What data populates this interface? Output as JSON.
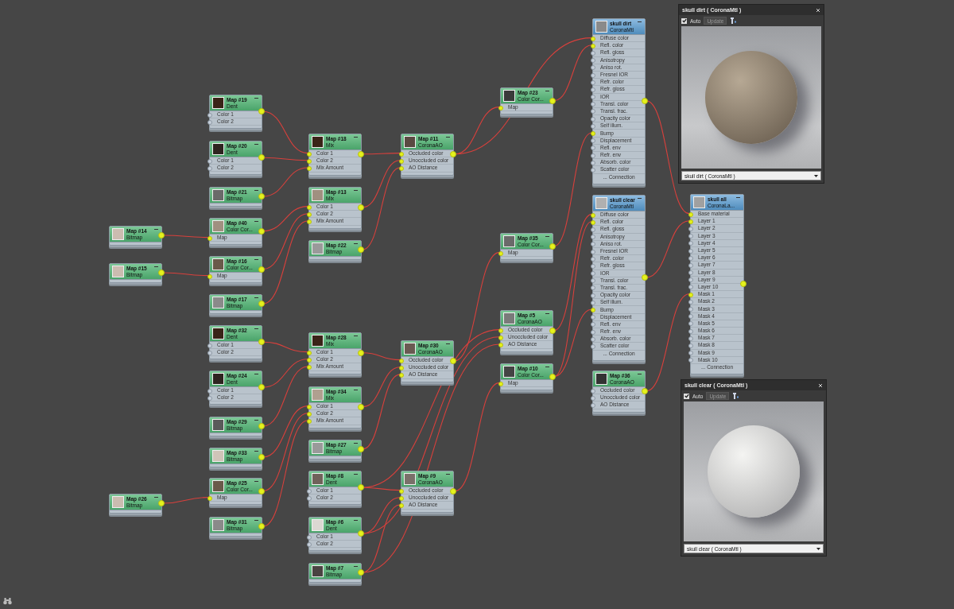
{
  "canvas": {
    "nodes": [
      {
        "kind": "map",
        "title": "Map #14",
        "type": "Bitmap"
      },
      {
        "kind": "map",
        "title": "Map #15",
        "type": "Bitmap"
      },
      {
        "kind": "map",
        "title": "Map #26",
        "type": "Bitmap"
      },
      {
        "kind": "map",
        "title": "Map #19",
        "type": "Dent",
        "slots": [
          {
            "label": "Color 1",
            "connected": false
          },
          {
            "label": "Color 2",
            "connected": false
          }
        ]
      },
      {
        "kind": "map",
        "title": "Map #20",
        "type": "Dent",
        "slots": [
          {
            "label": "Color 1",
            "connected": false
          },
          {
            "label": "Color 2",
            "connected": false
          }
        ]
      },
      {
        "kind": "map",
        "title": "Map #21",
        "type": "Bitmap"
      },
      {
        "kind": "map",
        "title": "Map #40",
        "type": "Color Cor...",
        "slots": [
          {
            "label": "Map",
            "connected": true
          }
        ]
      },
      {
        "kind": "map",
        "title": "Map #16",
        "type": "Color Cor...",
        "slots": [
          {
            "label": "Map",
            "connected": true
          }
        ]
      },
      {
        "kind": "map",
        "title": "Map #17",
        "type": "Bitmap"
      },
      {
        "kind": "map",
        "title": "Map #32",
        "type": "Dent",
        "slots": [
          {
            "label": "Color 1",
            "connected": false
          },
          {
            "label": "Color 2",
            "connected": false
          }
        ]
      },
      {
        "kind": "map",
        "title": "Map #24",
        "type": "Dent",
        "slots": [
          {
            "label": "Color 1",
            "connected": false
          },
          {
            "label": "Color 2",
            "connected": false
          }
        ]
      },
      {
        "kind": "map",
        "title": "Map #29",
        "type": "Bitmap"
      },
      {
        "kind": "map",
        "title": "Map #33",
        "type": "Bitmap"
      },
      {
        "kind": "map",
        "title": "Map #25",
        "type": "Color Cor...",
        "slots": [
          {
            "label": "Map",
            "connected": true
          }
        ]
      },
      {
        "kind": "map",
        "title": "Map #31",
        "type": "Bitmap"
      },
      {
        "kind": "map",
        "title": "Map #18",
        "type": "Mix",
        "slots": [
          {
            "label": "Color 1",
            "connected": true
          },
          {
            "label": "Color 2",
            "connected": true
          },
          {
            "label": "Mix Amount",
            "connected": true
          }
        ]
      },
      {
        "kind": "map",
        "title": "Map #13",
        "type": "Mix",
        "slots": [
          {
            "label": "Color 1",
            "connected": true
          },
          {
            "label": "Color 2",
            "connected": true
          },
          {
            "label": "Mix Amount",
            "connected": true
          }
        ]
      },
      {
        "kind": "map",
        "title": "Map #22",
        "type": "Bitmap"
      },
      {
        "kind": "map",
        "title": "Map #28",
        "type": "Mix",
        "slots": [
          {
            "label": "Color 1",
            "connected": true
          },
          {
            "label": "Color 2",
            "connected": true
          },
          {
            "label": "Mix Amount",
            "connected": true
          }
        ]
      },
      {
        "kind": "map",
        "title": "Map #34",
        "type": "Mix",
        "slots": [
          {
            "label": "Color 1",
            "connected": true
          },
          {
            "label": "Color 2",
            "connected": true
          },
          {
            "label": "Mix Amount",
            "connected": true
          }
        ]
      },
      {
        "kind": "map",
        "title": "Map #27",
        "type": "Bitmap"
      },
      {
        "kind": "map",
        "title": "Map #8",
        "type": "Dent",
        "slots": [
          {
            "label": "Color 1",
            "connected": false
          },
          {
            "label": "Color 2",
            "connected": false
          }
        ]
      },
      {
        "kind": "map",
        "title": "Map #6",
        "type": "Dent",
        "slots": [
          {
            "label": "Color 1",
            "connected": false
          },
          {
            "label": "Color 2",
            "connected": false
          }
        ]
      },
      {
        "kind": "map",
        "title": "Map #7",
        "type": "Bitmap"
      },
      {
        "kind": "map",
        "title": "Map #11",
        "type": "CoronaAO",
        "slots": [
          {
            "label": "Occluded color",
            "connected": true
          },
          {
            "label": "Unoccluded color",
            "connected": true
          },
          {
            "label": "AO Distance",
            "connected": true
          }
        ]
      },
      {
        "kind": "map",
        "title": "Map #30",
        "type": "CoronaAO",
        "slots": [
          {
            "label": "Occluded color",
            "connected": true
          },
          {
            "label": "Unoccluded color",
            "connected": true
          },
          {
            "label": "AO Distance",
            "connected": true
          }
        ]
      },
      {
        "kind": "map",
        "title": "Map #9",
        "type": "CoronaAO",
        "slots": [
          {
            "label": "Occluded color",
            "connected": true
          },
          {
            "label": "Unoccluded color",
            "connected": true
          },
          {
            "label": "AO Distance",
            "connected": true
          }
        ]
      },
      {
        "kind": "map",
        "title": "Map #23",
        "type": "Color Cor...",
        "slots": [
          {
            "label": "Map",
            "connected": true
          }
        ]
      },
      {
        "kind": "map",
        "title": "Map #35",
        "type": "Color Cor...",
        "slots": [
          {
            "label": "Map",
            "connected": true
          }
        ]
      },
      {
        "kind": "map",
        "title": "Map #5",
        "type": "CoronaAO",
        "slots": [
          {
            "label": "Occluded color",
            "connected": true
          },
          {
            "label": "Unoccluded color",
            "connected": true
          },
          {
            "label": "AO Distance",
            "connected": true
          }
        ]
      },
      {
        "kind": "map",
        "title": "Map #10",
        "type": "Color Cor...",
        "slots": [
          {
            "label": "Map",
            "connected": true
          }
        ]
      },
      {
        "kind": "material",
        "title": "skull dirt",
        "type": "CoronaMtl",
        "footer": "... Connection",
        "slots": [
          {
            "label": "Diffuse color",
            "connected": true
          },
          {
            "label": "Refl. color",
            "connected": true
          },
          {
            "label": "Refl. gloss",
            "connected": false
          },
          {
            "label": "Anisotropy",
            "connected": false
          },
          {
            "label": "Aniso rot.",
            "connected": false
          },
          {
            "label": "Fresnel IOR",
            "connected": false
          },
          {
            "label": "Refr. color",
            "connected": false
          },
          {
            "label": "Refr. gloss",
            "connected": false
          },
          {
            "label": "IOR",
            "connected": false
          },
          {
            "label": "Transl. color",
            "connected": false
          },
          {
            "label": "Transl. frac.",
            "connected": false
          },
          {
            "label": "Opacity color",
            "connected": false
          },
          {
            "label": "Self illum.",
            "connected": false
          },
          {
            "label": "Bump",
            "connected": true
          },
          {
            "label": "Displacement",
            "connected": false
          },
          {
            "label": "Refl. env",
            "connected": false
          },
          {
            "label": "Refr. env",
            "connected": false
          },
          {
            "label": "Absorb. color",
            "connected": false
          },
          {
            "label": "Scatter color",
            "connected": false
          }
        ]
      },
      {
        "kind": "material",
        "title": "skull clear",
        "type": "CoronaMtl",
        "footer": "... Connection",
        "slots": [
          {
            "label": "Diffuse color",
            "connected": true
          },
          {
            "label": "Refl. color",
            "connected": true
          },
          {
            "label": "Refl. gloss",
            "connected": false
          },
          {
            "label": "Anisotropy",
            "connected": false
          },
          {
            "label": "Aniso rot.",
            "connected": false
          },
          {
            "label": "Fresnel IOR",
            "connected": false
          },
          {
            "label": "Refr. color",
            "connected": false
          },
          {
            "label": "Refr. gloss",
            "connected": false
          },
          {
            "label": "IOR",
            "connected": false
          },
          {
            "label": "Transl. color",
            "connected": false
          },
          {
            "label": "Transl. frac.",
            "connected": false
          },
          {
            "label": "Opacity color",
            "connected": false
          },
          {
            "label": "Self illum.",
            "connected": false
          },
          {
            "label": "Bump",
            "connected": true
          },
          {
            "label": "Displacement",
            "connected": false
          },
          {
            "label": "Refl. env",
            "connected": false
          },
          {
            "label": "Refr. env",
            "connected": false
          },
          {
            "label": "Absorb. color",
            "connected": false
          },
          {
            "label": "Scatter color",
            "connected": false
          }
        ]
      },
      {
        "kind": "map",
        "title": "Map #36",
        "type": "CoronaAO",
        "slots": [
          {
            "label": "Occluded color",
            "connected": false
          },
          {
            "label": "Unoccluded color",
            "connected": false
          },
          {
            "label": "AO Distance",
            "connected": false
          }
        ]
      },
      {
        "kind": "material",
        "title": "skull all",
        "type": "CoronaLa...",
        "footer": "... Connection",
        "slots": [
          {
            "label": "Base material",
            "connected": true
          },
          {
            "label": "Layer 1",
            "connected": true
          },
          {
            "label": "Layer 2",
            "connected": false
          },
          {
            "label": "Layer 3",
            "connected": false
          },
          {
            "label": "Layer 4",
            "connected": false
          },
          {
            "label": "Layer 5",
            "connected": false
          },
          {
            "label": "Layer 6",
            "connected": false
          },
          {
            "label": "Layer 7",
            "connected": false
          },
          {
            "label": "Layer 8",
            "connected": false
          },
          {
            "label": "Layer 9",
            "connected": false
          },
          {
            "label": "Layer 10",
            "connected": false
          },
          {
            "label": "Mask 1",
            "connected": true
          },
          {
            "label": "Mask 2",
            "connected": false
          },
          {
            "label": "Mask 3",
            "connected": false
          },
          {
            "label": "Mask 4",
            "connected": false
          },
          {
            "label": "Mask 5",
            "connected": false
          },
          {
            "label": "Mask 6",
            "connected": false
          },
          {
            "label": "Mask 7",
            "connected": false
          },
          {
            "label": "Mask 8",
            "connected": false
          },
          {
            "label": "Mask 9",
            "connected": false
          },
          {
            "label": "Mask 10",
            "connected": false
          }
        ]
      }
    ],
    "preview_windows": [
      {
        "title": "skull dirt  ( CoronaMtl )",
        "auto_label": "Auto",
        "auto_checked": true,
        "update_label": "Update",
        "dropdown_value": "skull dirt  ( CoronaMtl )"
      },
      {
        "title": "skull clear  ( CoronaMtl )",
        "auto_label": "Auto",
        "auto_checked": true,
        "update_label": "Update",
        "dropdown_value": "skull clear  ( CoronaMtl )"
      }
    ]
  }
}
